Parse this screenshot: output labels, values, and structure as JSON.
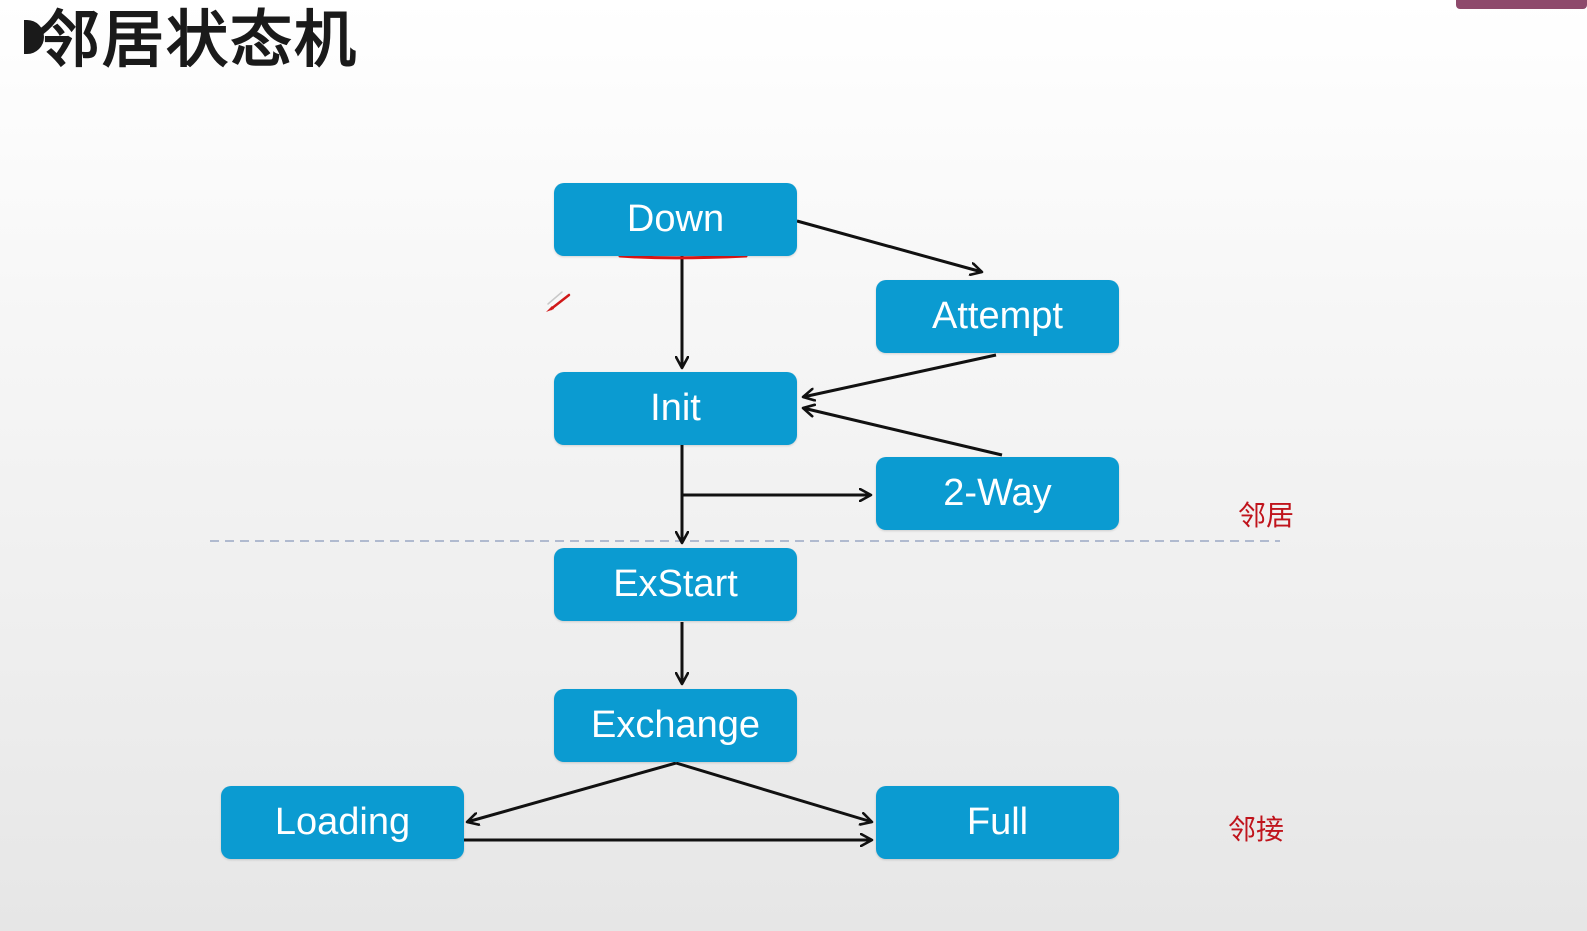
{
  "title": "邻居状态机",
  "colors": {
    "box_fill": "#0b9bd1",
    "box_text": "#ffffff",
    "arrow": "#111111",
    "divider": "#9aa8c4",
    "label": "#c0141c",
    "underline": "#e01818"
  },
  "states": {
    "down": "Down",
    "attempt": "Attempt",
    "init": "Init",
    "two_way": "2-Way",
    "exstart": "ExStart",
    "exchange": "Exchange",
    "loading": "Loading",
    "full": "Full"
  },
  "zones": {
    "neighbor": "邻居",
    "adjacency": "邻接"
  },
  "transitions": [
    {
      "from": "Down",
      "to": "Attempt"
    },
    {
      "from": "Down",
      "to": "Init"
    },
    {
      "from": "Attempt",
      "to": "Init"
    },
    {
      "from": "2-Way",
      "to": "Init"
    },
    {
      "from": "Init",
      "to": "2-Way"
    },
    {
      "from": "Init",
      "to": "ExStart"
    },
    {
      "from": "ExStart",
      "to": "Exchange"
    },
    {
      "from": "Exchange",
      "to": "Loading"
    },
    {
      "from": "Exchange",
      "to": "Full"
    },
    {
      "from": "Loading",
      "to": "Full"
    }
  ]
}
